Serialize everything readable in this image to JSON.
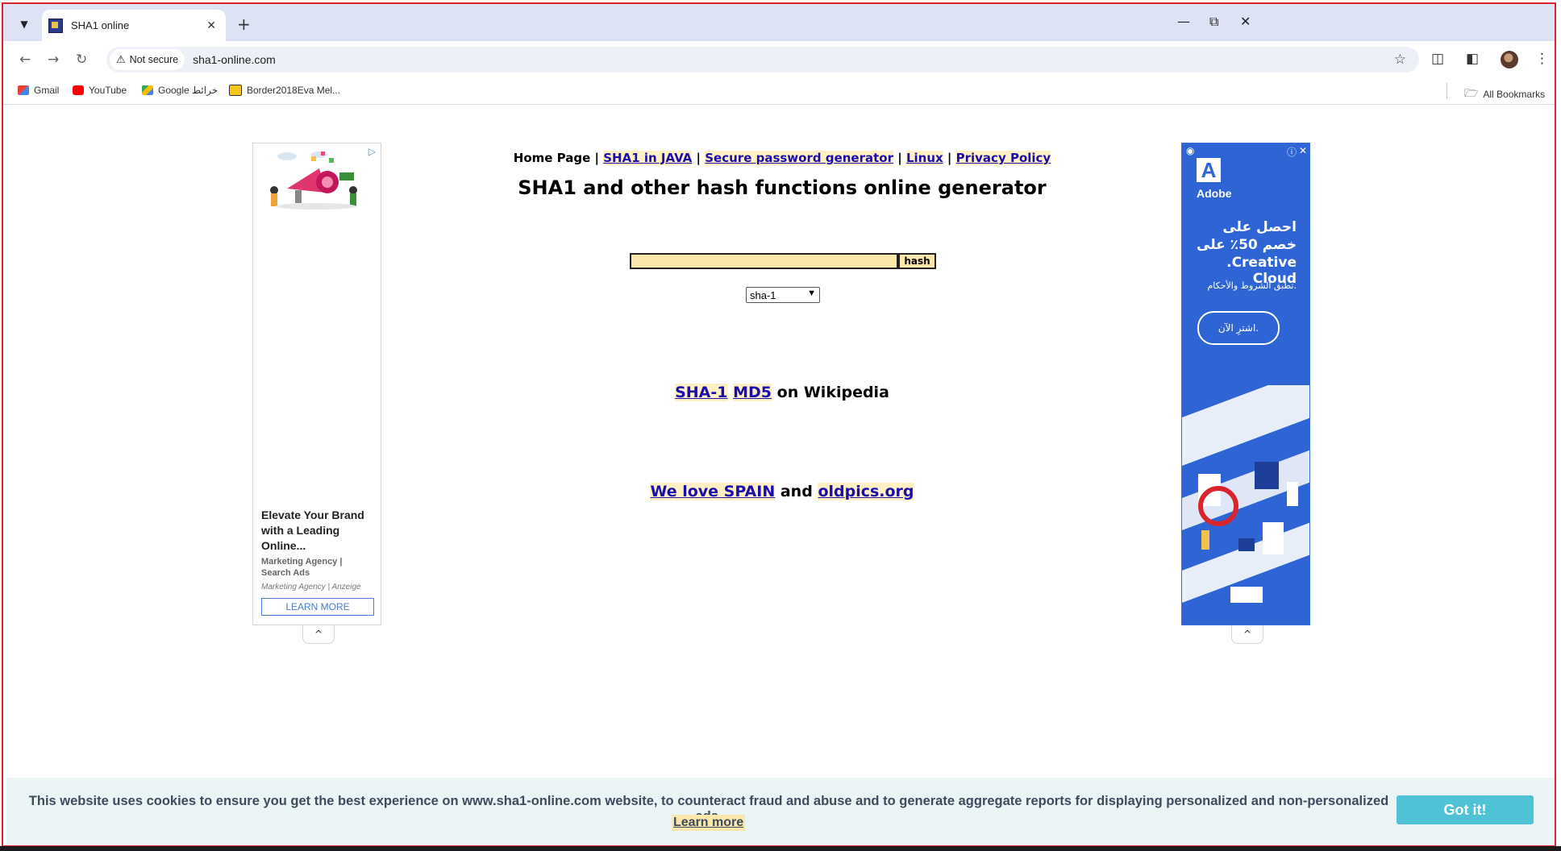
{
  "browser": {
    "tab_title": "SHA1 online",
    "new_tab": "+",
    "security_label": "Not secure",
    "url": "sha1-online.com",
    "window_minimize": "—",
    "window_restore": "⧉",
    "window_close": "✕"
  },
  "bookmarks": [
    {
      "label": "Gmail"
    },
    {
      "label": "YouTube"
    },
    {
      "label": "Google خرائط"
    },
    {
      "label": "Border2018Eva Mel..."
    }
  ],
  "bookmarks_all": "All Bookmarks",
  "nav": {
    "home": "Home Page",
    "sep": "|",
    "sha1_java": "SHA1 in JAVA",
    "password_gen": "Secure password generator",
    "linux": "Linux",
    "privacy": "Privacy Policy"
  },
  "title": "SHA1 and other hash functions online generator",
  "form": {
    "input_value": "",
    "hash_button": "hash",
    "algorithm_selected": "sha-1"
  },
  "wiki": {
    "sha1": "SHA-1",
    "md5": "MD5",
    "suffix": "on Wikipedia"
  },
  "love": {
    "spain": "We love SPAIN",
    "and": "and",
    "oldpics": "oldpics.org"
  },
  "ad_left": {
    "headline": "Elevate Your Brand with a Leading Online...",
    "subline": "Marketing Agency | Search Ads",
    "source": "Marketing Agency | Anzeige",
    "cta": "LEARN MORE"
  },
  "ad_right": {
    "brand": "Adobe",
    "line1": "احصل على",
    "line2": "خصم 50٪ على",
    "line3": ".Creative Cloud",
    "terms": "تطبق الشروط والأحكام.",
    "cta": "اشترِ الآن."
  },
  "cookie": {
    "text": "This website uses cookies to ensure you get the best experience on www.sha1-online.com website, to counteract fraud and abuse and to generate aggregate reports for displaying personalized and non-personalized ads.",
    "learn_more": "Learn more",
    "button": "Got it!"
  },
  "colors": {
    "link": "#1a0dab",
    "link_highlight": "#fdf0c3",
    "input_bg": "#fbe6ac",
    "cookie_button": "#50c2d6",
    "adobe_blue": "#2f64d4"
  }
}
